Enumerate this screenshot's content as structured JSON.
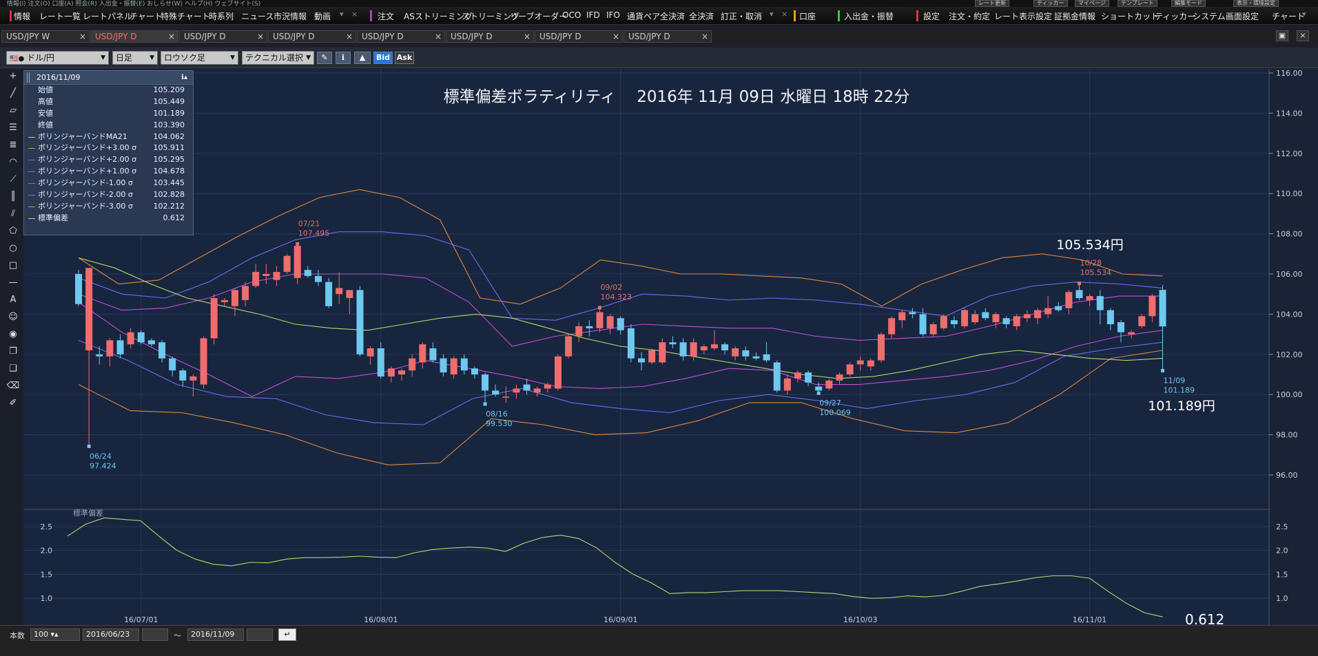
{
  "topstrip": {
    "left_text": "情報(I) 注文(O) 口座(A) 照会(R) 入出金・振替(E) おしらせ(W) ヘルプ(H) ウェブサイト(S)",
    "right_buttons": [
      "レート更新",
      "ティッカー",
      "マイページ",
      "テンプレート",
      "編集モード",
      "表示・環境設定"
    ]
  },
  "menubar": {
    "items_a": [
      "情報",
      "レート一覧",
      "レートパネル",
      "チャート",
      "特殊チャート",
      "時系列",
      "ニュース",
      "市況情報",
      "動画"
    ],
    "items_b": [
      "注文",
      "ASストリーミング",
      "ストリーミング",
      "リーブオーダー",
      "OCO",
      "IFD",
      "IFO",
      "通貨ペア全決済",
      "全決済",
      "訂正・取消"
    ],
    "item_account": "口座",
    "item_deposit": "入出金・振替",
    "items_c": [
      "設定",
      "注文・約定",
      "レート表示設定",
      "証拠金情報",
      "ショートカット",
      "ティッカー",
      "システム",
      "画面設定",
      "チャート"
    ]
  },
  "tabs": [
    {
      "label": "USD/JPY W"
    },
    {
      "label": "USD/JPY D"
    },
    {
      "label": "USD/JPY D"
    },
    {
      "label": "USD/JPY D"
    },
    {
      "label": "USD/JPY D"
    },
    {
      "label": "USD/JPY D"
    },
    {
      "label": "USD/JPY D"
    },
    {
      "label": "USD/JPY D"
    }
  ],
  "toolbar": {
    "pair": "ドル/円",
    "period": "日足",
    "chart_type": "ロウソク足",
    "technical": "テクニカル選択",
    "bid": "Bid",
    "ask": "Ask"
  },
  "infopanel": {
    "date": "2016/11/09",
    "rows": [
      {
        "label": "始値",
        "value": "105.209",
        "color": ""
      },
      {
        "label": "高値",
        "value": "105.449",
        "color": ""
      },
      {
        "label": "安値",
        "value": "101.189",
        "color": ""
      },
      {
        "label": "終値",
        "value": "103.390",
        "color": ""
      },
      {
        "label": "ボリンジャーバンドMA21",
        "value": "104.062",
        "color": "#b8d86b"
      },
      {
        "label": "ボリンジャーバンド+3.00 σ",
        "value": "105.911",
        "color": "#e08a3a"
      },
      {
        "label": "ボリンジャーバンド+2.00 σ",
        "value": "105.295",
        "color": "#6a6df0"
      },
      {
        "label": "ボリンジャーバンド+1.00 σ",
        "value": "104.678",
        "color": "#c050d8"
      },
      {
        "label": "ボリンジャーバンド-1.00 σ",
        "value": "103.445",
        "color": "#c050d8"
      },
      {
        "label": "ボリンジャーバンド-2.00 σ",
        "value": "102.828",
        "color": "#6a6df0"
      },
      {
        "label": "ボリンジャーバンド-3.00 σ",
        "value": "102.212",
        "color": "#e08a3a"
      },
      {
        "label": "標準偏差",
        "value": "0.612",
        "color": "#b8d86b"
      }
    ]
  },
  "chart_annotation": {
    "headline": "標準偏差ボラティリティ　 2016年 11月 09日 水曜日 18時 22分",
    "high_label": "105.534円",
    "low_label": "101.189円",
    "sd_label": "0.612"
  },
  "chart_data": [
    {
      "type": "candlestick",
      "title": "",
      "ylim": [
        95.0,
        116.0
      ],
      "y_ticks": [
        "116.00",
        "114.00",
        "112.00",
        "110.00",
        "108.00",
        "106.00",
        "104.00",
        "102.00",
        "100.00",
        "98.00",
        "96.00"
      ],
      "x_tick_labels": [
        "16/07/01",
        "16/08/01",
        "16/09/01",
        "16/10/03",
        "16/11/01"
      ],
      "x_tick_index": [
        6,
        29,
        52,
        75,
        97
      ],
      "candles": [
        [
          106.0,
          106.2,
          104.4,
          104.5
        ],
        [
          102.2,
          106.3,
          97.42,
          106.3
        ],
        [
          102.0,
          102.4,
          101.5,
          101.9
        ],
        [
          101.9,
          102.8,
          101.4,
          102.7
        ],
        [
          102.7,
          103.0,
          101.8,
          102.0
        ],
        [
          102.5,
          103.3,
          102.3,
          103.1
        ],
        [
          103.1,
          103.2,
          102.5,
          102.6
        ],
        [
          102.7,
          102.8,
          102.4,
          102.5
        ],
        [
          102.6,
          102.7,
          101.6,
          101.8
        ],
        [
          101.8,
          101.9,
          100.9,
          101.2
        ],
        [
          101.2,
          101.3,
          100.4,
          100.7
        ],
        [
          100.7,
          101.0,
          99.9,
          100.9
        ],
        [
          100.5,
          102.9,
          100.3,
          102.8
        ],
        [
          102.8,
          105.0,
          102.5,
          104.8
        ],
        [
          104.6,
          104.8,
          104.4,
          104.7
        ],
        [
          104.4,
          105.3,
          103.9,
          105.2
        ],
        [
          104.7,
          105.6,
          104.4,
          105.4
        ],
        [
          105.4,
          106.5,
          105.3,
          106.1
        ],
        [
          105.9,
          106.5,
          105.5,
          106.0
        ],
        [
          105.7,
          106.4,
          105.4,
          106.1
        ],
        [
          106.1,
          107.0,
          106.0,
          106.9
        ],
        [
          105.8,
          107.5,
          105.5,
          107.4
        ],
        [
          106.2,
          106.4,
          105.8,
          105.9
        ],
        [
          105.9,
          106.2,
          105.4,
          105.6
        ],
        [
          105.6,
          105.8,
          104.3,
          104.4
        ],
        [
          105.0,
          106.1,
          104.5,
          105.3
        ],
        [
          104.8,
          105.2,
          104.0,
          105.2
        ],
        [
          105.2,
          105.4,
          101.9,
          102.0
        ],
        [
          101.9,
          102.4,
          101.5,
          102.3
        ],
        [
          102.3,
          102.6,
          100.8,
          100.9
        ],
        [
          100.9,
          101.4,
          100.6,
          101.3
        ],
        [
          101.0,
          101.3,
          100.7,
          101.2
        ],
        [
          101.2,
          102.0,
          100.9,
          101.8
        ],
        [
          101.6,
          102.6,
          101.3,
          102.5
        ],
        [
          102.3,
          102.6,
          101.6,
          101.7
        ],
        [
          101.8,
          102.0,
          100.9,
          101.1
        ],
        [
          101.0,
          101.9,
          100.8,
          101.8
        ],
        [
          101.8,
          102.0,
          101.0,
          101.2
        ],
        [
          101.3,
          101.4,
          100.8,
          101.0
        ],
        [
          101.0,
          101.1,
          99.53,
          100.2
        ],
        [
          100.2,
          100.5,
          99.9,
          100.0
        ],
        [
          99.9,
          100.4,
          99.6,
          99.9
        ],
        [
          100.1,
          100.5,
          99.8,
          100.3
        ],
        [
          100.5,
          100.8,
          100.0,
          100.2
        ],
        [
          100.1,
          100.4,
          99.9,
          100.3
        ],
        [
          100.3,
          100.6,
          100.1,
          100.5
        ],
        [
          100.3,
          102.0,
          100.2,
          101.9
        ],
        [
          101.9,
          103.0,
          101.8,
          102.9
        ],
        [
          102.9,
          103.6,
          102.6,
          103.4
        ],
        [
          103.4,
          103.7,
          102.9,
          103.3
        ],
        [
          103.3,
          104.3,
          103.1,
          104.1
        ],
        [
          103.3,
          104.0,
          103.0,
          103.9
        ],
        [
          103.8,
          103.9,
          103.0,
          103.2
        ],
        [
          103.3,
          103.5,
          101.6,
          101.8
        ],
        [
          101.8,
          102.1,
          101.2,
          101.6
        ],
        [
          101.6,
          102.3,
          101.5,
          102.2
        ],
        [
          101.6,
          102.8,
          101.5,
          102.6
        ],
        [
          102.6,
          102.9,
          102.3,
          102.5
        ],
        [
          102.6,
          102.8,
          101.7,
          101.9
        ],
        [
          101.9,
          102.8,
          101.7,
          102.6
        ],
        [
          102.2,
          102.5,
          102.0,
          102.4
        ],
        [
          102.3,
          103.2,
          102.2,
          102.5
        ],
        [
          102.5,
          102.6,
          102.0,
          102.2
        ],
        [
          101.9,
          102.4,
          101.7,
          102.3
        ],
        [
          102.2,
          102.4,
          101.7,
          101.9
        ],
        [
          101.9,
          102.1,
          101.7,
          101.8
        ],
        [
          102.0,
          102.6,
          101.6,
          101.7
        ],
        [
          101.6,
          101.7,
          100.1,
          100.2
        ],
        [
          100.2,
          101.0,
          100.0,
          100.8
        ],
        [
          100.8,
          101.2,
          100.6,
          101.1
        ],
        [
          101.1,
          101.2,
          100.4,
          100.6
        ],
        [
          100.4,
          100.6,
          100.07,
          100.2
        ],
        [
          100.3,
          100.8,
          100.2,
          100.7
        ],
        [
          100.7,
          101.1,
          100.5,
          101.0
        ],
        [
          101.0,
          101.6,
          100.9,
          101.5
        ],
        [
          101.5,
          101.9,
          101.2,
          101.7
        ],
        [
          101.4,
          101.8,
          101.2,
          101.7
        ],
        [
          101.7,
          103.1,
          101.6,
          103.0
        ],
        [
          103.0,
          103.9,
          102.8,
          103.8
        ],
        [
          103.7,
          104.2,
          103.3,
          104.1
        ],
        [
          104.1,
          104.3,
          103.8,
          104.0
        ],
        [
          104.0,
          104.3,
          102.9,
          103.0
        ],
        [
          103.0,
          103.6,
          102.9,
          103.5
        ],
        [
          103.3,
          104.0,
          103.2,
          103.9
        ],
        [
          103.7,
          103.9,
          103.3,
          103.5
        ],
        [
          103.4,
          104.3,
          103.3,
          104.2
        ],
        [
          103.6,
          104.2,
          103.5,
          104.0
        ],
        [
          104.1,
          104.3,
          103.7,
          103.8
        ],
        [
          103.6,
          104.1,
          103.3,
          104.0
        ],
        [
          103.8,
          103.9,
          103.3,
          103.5
        ],
        [
          103.4,
          104.0,
          103.2,
          103.9
        ],
        [
          103.8,
          104.2,
          103.6,
          104.0
        ],
        [
          103.8,
          104.3,
          103.5,
          104.2
        ],
        [
          104.0,
          104.9,
          103.8,
          104.3
        ],
        [
          104.4,
          104.6,
          104.1,
          104.2
        ],
        [
          104.3,
          105.2,
          104.0,
          105.1
        ],
        [
          105.2,
          105.534,
          104.7,
          104.8
        ],
        [
          104.7,
          105.0,
          104.4,
          104.9
        ],
        [
          104.9,
          105.2,
          103.5,
          104.2
        ],
        [
          104.2,
          104.3,
          103.2,
          103.5
        ],
        [
          103.6,
          103.7,
          102.6,
          103.1
        ],
        [
          103.0,
          103.2,
          102.8,
          103.1
        ],
        [
          103.4,
          104.0,
          103.3,
          103.9
        ],
        [
          103.9,
          105.0,
          103.6,
          104.9
        ],
        [
          105.209,
          105.449,
          101.189,
          103.39
        ]
      ],
      "bollinger": {
        "ma21": [
          106.8,
          106.3,
          105.5,
          104.8,
          104.4,
          104.0,
          103.5,
          103.3,
          103.2,
          103.5,
          103.8,
          104.0,
          103.8,
          103.3,
          102.8,
          102.4,
          102.2,
          101.9,
          101.6,
          101.3,
          101.0,
          100.8,
          100.9,
          101.2,
          101.6,
          102.0,
          102.2,
          102.0,
          101.8,
          101.7,
          101.8
        ],
        "p3": [
          106.8,
          105.5,
          105.7,
          106.8,
          107.9,
          108.9,
          109.8,
          110.2,
          109.8,
          108.7,
          104.8,
          104.5,
          105.3,
          106.7,
          106.4,
          106.0,
          106.0,
          105.9,
          105.8,
          105.5,
          104.4,
          105.5,
          106.2,
          106.8,
          107.0,
          106.7,
          106.0,
          105.9
        ],
        "p2": [
          105.8,
          105.0,
          104.8,
          105.6,
          106.8,
          107.7,
          108.1,
          108.1,
          107.9,
          107.2,
          103.8,
          103.7,
          104.3,
          105.0,
          104.9,
          104.7,
          104.8,
          104.7,
          104.5,
          104.2,
          103.9,
          104.9,
          105.4,
          105.6,
          105.5,
          105.3
        ],
        "p1": [
          105.0,
          104.2,
          104.3,
          104.8,
          105.6,
          106.0,
          106.0,
          106.0,
          105.8,
          104.6,
          102.4,
          102.9,
          103.2,
          103.5,
          103.4,
          103.3,
          103.3,
          102.9,
          102.7,
          102.8,
          102.9,
          103.4,
          104.0,
          104.6,
          104.9,
          104.9
        ],
        "m1": [
          104.6,
          103.1,
          102.0,
          101.0,
          99.9,
          100.9,
          100.8,
          101.1,
          101.7,
          101.3,
          100.9,
          100.4,
          100.3,
          100.4,
          100.8,
          101.3,
          101.2,
          100.5,
          100.5,
          100.7,
          100.9,
          101.2,
          101.7,
          102.4,
          102.9,
          103.2
        ],
        "m2": [
          102.7,
          101.7,
          100.5,
          99.9,
          99.8,
          99.0,
          98.6,
          98.5,
          99.8,
          100.3,
          99.6,
          99.3,
          99.1,
          99.7,
          100.0,
          99.7,
          99.3,
          99.7,
          100.0,
          100.6,
          101.9,
          102.3,
          102.6
        ],
        "m3": [
          100.5,
          99.2,
          99.1,
          98.6,
          98.0,
          97.1,
          96.5,
          96.6,
          98.8,
          98.5,
          98.0,
          98.1,
          98.7,
          99.6,
          99.6,
          98.8,
          98.2,
          98.1,
          98.6,
          100.0,
          101.8,
          102.2
        ]
      },
      "annotations": [
        {
          "date": "06/24",
          "price": "97.424"
        },
        {
          "date": "07/21",
          "price": "107.495"
        },
        {
          "date": "08/16",
          "price": "99.530"
        },
        {
          "date": "09/02",
          "price": "104.323"
        },
        {
          "date": "09/27",
          "price": "100.069"
        },
        {
          "date": "10/28",
          "price": "105.534"
        },
        {
          "date": "11/09",
          "price": "101.189"
        }
      ]
    },
    {
      "type": "line",
      "title": "標準偏差",
      "ylim": [
        0.5,
        2.8
      ],
      "y_ticks": [
        "2.5",
        "2.0",
        "1.5",
        "1.0"
      ],
      "series": [
        {
          "values": [
            2.3,
            2.55,
            2.68,
            2.65,
            2.62,
            2.3,
            2.0,
            1.82,
            1.71,
            1.68,
            1.75,
            1.74,
            1.82,
            1.85,
            1.85,
            1.86,
            1.88,
            1.86,
            1.85,
            1.95,
            2.02,
            2.05,
            2.07,
            2.05,
            1.98,
            2.15,
            2.27,
            2.32,
            2.25,
            2.05,
            1.75,
            1.5,
            1.32,
            1.1,
            1.12,
            1.12,
            1.14,
            1.16,
            1.16,
            1.16,
            1.14,
            1.12,
            1.1,
            1.04,
            1.0,
            1.01,
            1.05,
            1.03,
            1.06,
            1.15,
            1.25,
            1.3,
            1.36,
            1.43,
            1.47,
            1.47,
            1.42,
            1.15,
            0.9,
            0.7,
            0.612
          ]
        }
      ]
    }
  ]
}
